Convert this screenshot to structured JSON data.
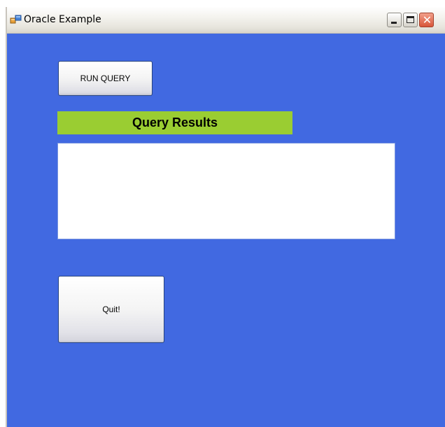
{
  "window": {
    "title": "Oracle Example",
    "background_color": "#4169e1",
    "icon": "app-window-icon"
  },
  "titlebar_buttons": {
    "minimize_icon": "minimize-icon",
    "maximize_icon": "maximize-icon",
    "close_icon": "close-icon",
    "close_glyph": "✕"
  },
  "main": {
    "run_query_label": "RUN QUERY",
    "results_header": "Query Results",
    "results_header_color": "#9acd32",
    "results_content": "",
    "quit_label": "Quit!"
  }
}
